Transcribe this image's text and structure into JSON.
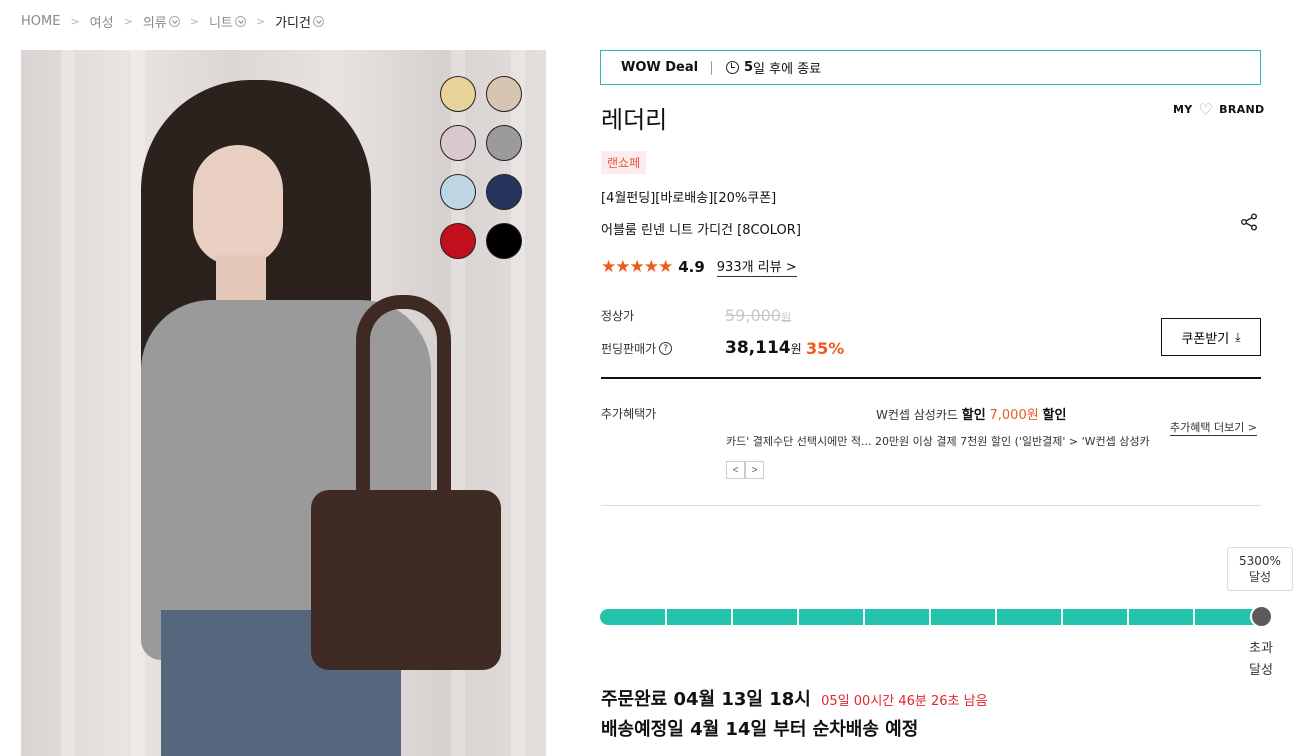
{
  "breadcrumb": {
    "items": [
      "HOME",
      "여성",
      "의류",
      "니트",
      "가디건"
    ]
  },
  "product_image": {
    "swatches": [
      "#e7d29a",
      "#d7c4b2",
      "#dac8cf",
      "#9b9b9b",
      "#bed5e4",
      "#27345c",
      "#c10f1d",
      "#000000"
    ]
  },
  "deal": {
    "label": "WOW Deal",
    "days": "5",
    "ends_text": "일 후에 종료"
  },
  "brand": {
    "name": "레더리",
    "my_label": "MY",
    "brand_label": "BRAND"
  },
  "tag": "랜쇼페",
  "product": {
    "title_line1": "[4월펀딩][바로배송][20%쿠폰]",
    "title_line2": "어블룸 린넨 니트 가디건 [8COLOR]",
    "stars": "★★★★★",
    "rating": "4.9",
    "review_link": "933개 리뷰"
  },
  "price": {
    "regular_label": "정상가",
    "regular_value": "59,000",
    "regular_unit": "원",
    "funding_label": "펀딩판매가",
    "sale_value": "38,114",
    "sale_unit": "원",
    "discount": "35%",
    "coupon_button": "쿠폰받기"
  },
  "benefit": {
    "label": "추가혜택가",
    "title_prefix": "W컨셉 삼성카드",
    "title_bold1": "할인",
    "title_amount": "7,000원",
    "title_bold2": "할인",
    "desc": "카드' 결제수단 선택시에만 적... 20만원 이상 결제 7천원 할인 ('일반결제' > 'W컨셉 삼성카",
    "more_link": "추가혜택 더보기",
    "colors": {
      "accent": "#ef5b1f"
    }
  },
  "funding": {
    "achieve_percent": "5300%",
    "achieve_text": "달성",
    "progress": 1.0,
    "over_line1": "초과",
    "over_line2": "달성",
    "bar_color": "#24c3ae"
  },
  "order": {
    "order_text": "주문완료 04월 13일 18시",
    "countdown": "05일 00시간 46분 26초 남음",
    "ship_text": "배송예정일 4월 14일 부터 순차배송 예정"
  }
}
